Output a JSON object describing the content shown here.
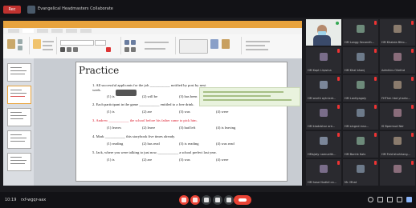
{
  "topbar": {
    "rec_label": "Rec",
    "room_title": "Evangelical Headmasters Collaborate"
  },
  "slide": {
    "title": "Practice",
    "questions": [
      {
        "text": "1. All successful applicants for the job ___________ notified by post by next"
      },
      {
        "text": "week."
      },
      {
        "text": "2. Each participant in the game ___________ entitled to a free drink."
      },
      {
        "text": "3. Andrew ___________ the school before his father came to pick him."
      },
      {
        "text": "4. Mark ___________ this storybook five times already."
      },
      {
        "text": "5. Jack, where you were talking to just now, ___________ a school prefect last year."
      }
    ],
    "options": [
      [
        "(1) is",
        "(2) will be",
        "(3) has been",
        "(4) is being"
      ],
      [
        "(1) is",
        "(2) are",
        "(3) was",
        "(4) were"
      ],
      [
        "(1) leaves",
        "(2) leave",
        "(3) had left",
        "(4) is leaving"
      ],
      [
        "(1) reading",
        "(2) has read",
        "(3) is reading",
        "(4) was read"
      ],
      [
        "(1) is",
        "(2) are",
        "(3) was",
        "(4) were"
      ]
    ]
  },
  "participants": [
    {
      "name": "",
      "camera": true
    },
    {
      "name": "HM Longg Secondh...",
      "camera": false
    },
    {
      "name": "HM Khalala Bhio...",
      "camera": false
    },
    {
      "name": "HM Kapt Lirpsina",
      "camera": false
    },
    {
      "name": "HM Khal bhanj",
      "camera": false
    },
    {
      "name": "Admhins Oliethd",
      "camera": false
    },
    {
      "name": "HM worth aytnicdr...",
      "camera": false
    },
    {
      "name": "HM Lantiyagaly",
      "camera": false
    },
    {
      "name": "FHThm hbd yharto...",
      "camera": false
    },
    {
      "name": "HM kiadcbhar ant...",
      "camera": false
    },
    {
      "name": "HM singnd msn...",
      "camera": false
    },
    {
      "name": "IS Bpermud Ndr",
      "camera": false
    },
    {
      "name": "HMajaty namuelth...",
      "camera": false
    },
    {
      "name": "HM Bonhk Kats",
      "camera": false
    },
    {
      "name": "HM Feld bhahhang...",
      "camera": false
    },
    {
      "name": "HM hose Nudbil ca...",
      "camera": false
    },
    {
      "name": "Mr. Mhat",
      "camera": false
    },
    {
      "name": "",
      "camera": false
    }
  ],
  "bottombar": {
    "time": "10:19",
    "meeting_code": "rxf-wgqr-aax"
  },
  "colors": {
    "accent": "#e8a33d",
    "danger": "#ea4335",
    "meet_bg": "#1b1b1f"
  },
  "icons": [
    "mic-off-icon",
    "camera-off-icon",
    "caption-icon",
    "raise-hand-icon",
    "present-icon",
    "more-icon",
    "end-call-icon",
    "info-icon",
    "people-icon",
    "chat-icon",
    "activities-icon"
  ]
}
